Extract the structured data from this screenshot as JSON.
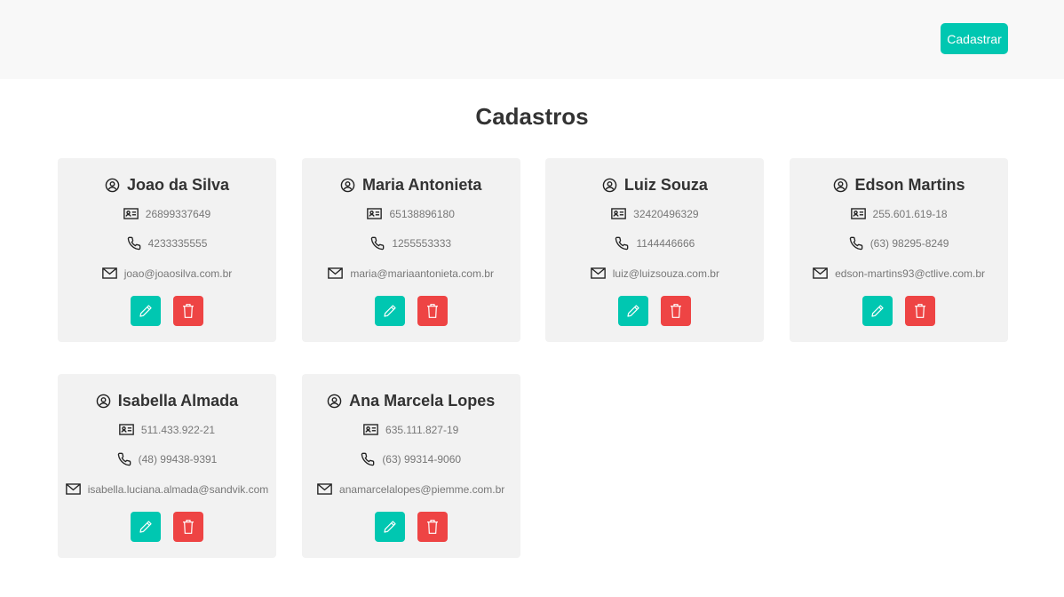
{
  "header": {
    "button_label": "Cadastrar"
  },
  "page": {
    "title": "Cadastros"
  },
  "colors": {
    "accent": "#00c7b1",
    "danger": "#ee4444",
    "card_bg": "#f2f2f2"
  },
  "icons": {
    "name": "user-circle-icon",
    "document": "id-card-icon",
    "phone": "phone-icon",
    "email": "mail-icon",
    "edit": "pencil-icon",
    "delete": "trash-icon"
  },
  "cards": [
    {
      "name": "Joao da Silva",
      "document": "26899337649",
      "phone": "4233335555",
      "email": "joao@joaosilva.com.br"
    },
    {
      "name": "Maria Antonieta",
      "document": "65138896180",
      "phone": "1255553333",
      "email": "maria@mariaantonieta.com.br"
    },
    {
      "name": "Luiz Souza",
      "document": "32420496329",
      "phone": "1144446666",
      "email": "luiz@luizsouza.com.br"
    },
    {
      "name": "Edson Martins",
      "document": "255.601.619-18",
      "phone": "(63) 98295-8249",
      "email": "edson-martins93@ctlive.com.br"
    },
    {
      "name": "Isabella Almada",
      "document": "511.433.922-21",
      "phone": "(48) 99438-9391",
      "email": "isabella.luciana.almada@sandvik.com"
    },
    {
      "name": "Ana Marcela Lopes",
      "document": "635.111.827-19",
      "phone": "(63) 99314-9060",
      "email": "anamarcelalopes@piemme.com.br"
    }
  ]
}
